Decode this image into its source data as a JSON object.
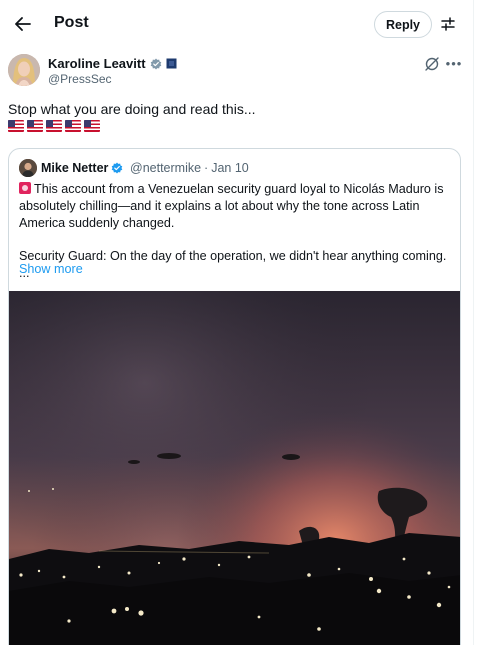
{
  "header": {
    "title": "Post",
    "reply_label": "Reply"
  },
  "post": {
    "author_name": "Karoline Leavitt",
    "handle": "@PressSec",
    "text": "Stop what you are doing and read this...",
    "flags_count_label": "5 US flags"
  },
  "quote": {
    "author_name": "Mike Netter",
    "handle": "@nettermike",
    "separator": "·",
    "date": "Jan 10",
    "text_line1": "This account from a Venezuelan security guard loyal to Nicolás Maduro is absolutely chilling—and it explains a lot about why the tone across Latin America suddenly changed.",
    "text_line2": "Security Guard: On the day of the operation, we didn't hear anything coming. ...",
    "show_more": "Show more"
  },
  "colors": {
    "accent": "#1d9bf0",
    "secondary_text": "#536471",
    "border": "#cfd9de",
    "verified_badge": "#1d9bf0"
  },
  "icons": {
    "back": "arrow-left-icon",
    "adjust": "sliders-icon",
    "verified": "verified-badge-icon",
    "affiliation": "government-affiliation-icon",
    "grok": "grok-icon",
    "more": "more-dots-icon"
  }
}
